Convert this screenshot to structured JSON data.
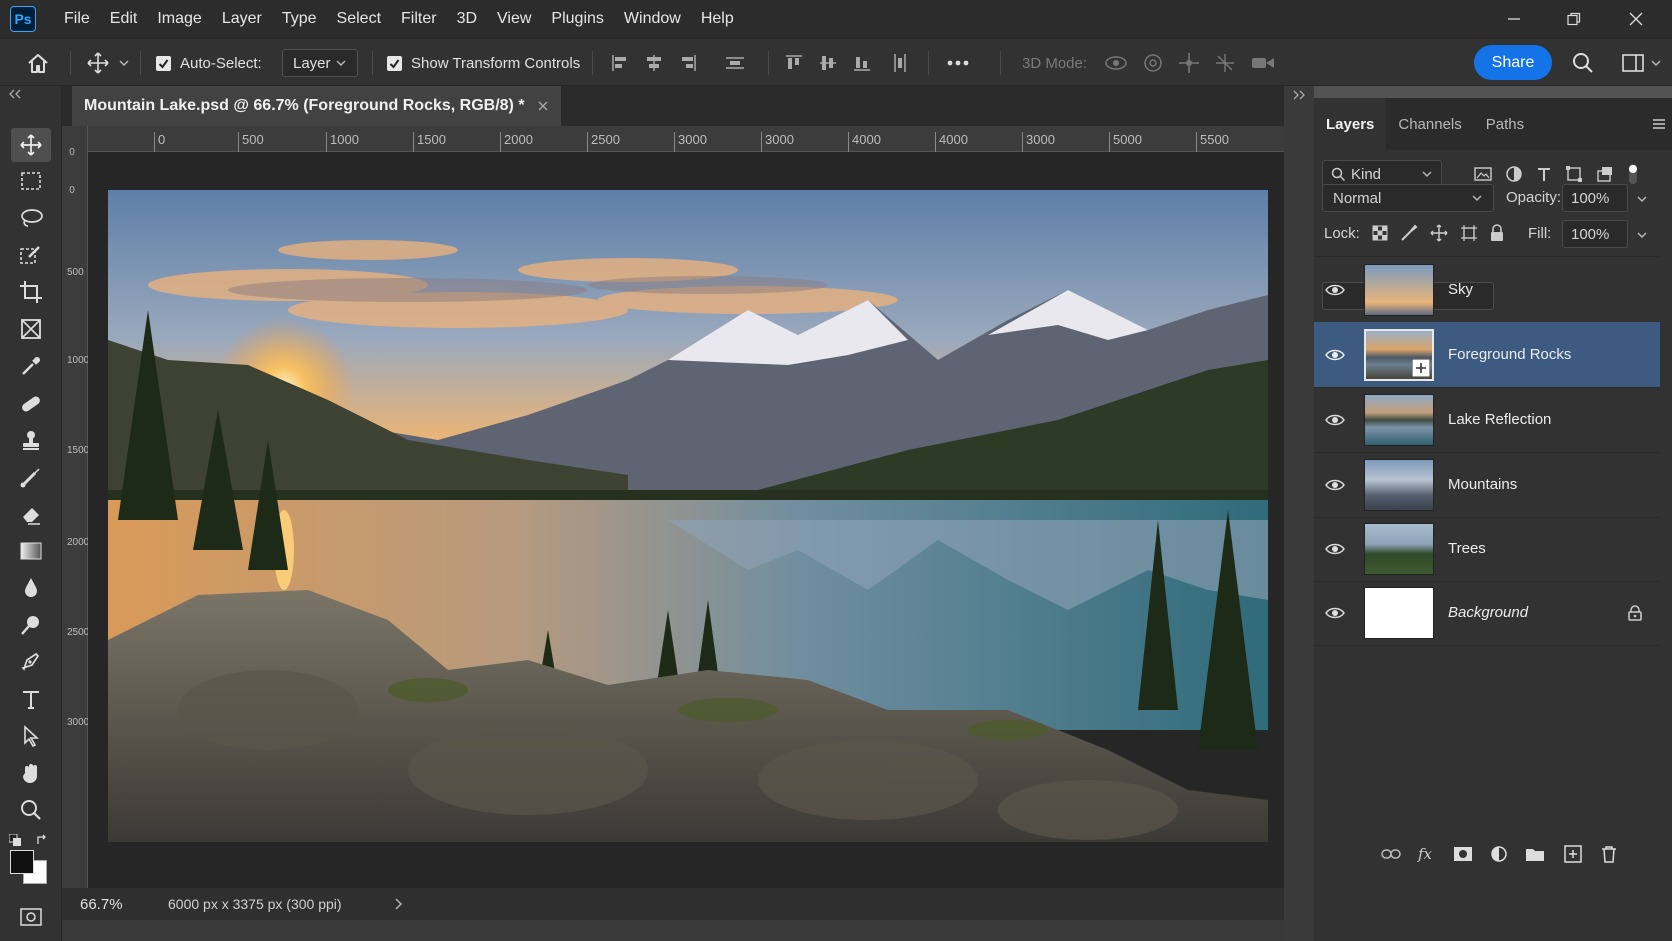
{
  "app": {
    "logo": "Ps"
  },
  "menu": [
    "File",
    "Edit",
    "Image",
    "Layer",
    "Type",
    "Select",
    "Filter",
    "3D",
    "View",
    "Plugins",
    "Window",
    "Help"
  ],
  "window_controls": [
    "minimize-icon",
    "restore-icon",
    "close-icon"
  ],
  "options": {
    "auto_select_label": "Auto-Select:",
    "auto_select_checked": true,
    "auto_select_target": "Layer",
    "show_transform_label": "Show Transform Controls",
    "show_transform_checked": true,
    "mode_3d_label": "3D Mode:",
    "share_label": "Share"
  },
  "document": {
    "tab_title": "Mountain Lake.psd @ 66.7% (Foreground Rocks, RGB/8) *",
    "ruler_top": [
      "0",
      "500",
      "1000",
      "1500",
      "2000",
      "2500",
      "3000",
      "3000",
      "4000",
      "4000",
      "3000",
      "5000",
      "5500"
    ],
    "ruler_left": [
      "0",
      "0",
      "500",
      "1000",
      "1500",
      "2000",
      "2500",
      "3000"
    ],
    "zoom": "66.7%",
    "dimensions": "6000 px x 3375 px (300 ppi)"
  },
  "layers_panel": {
    "tabs": [
      "Layers",
      "Channels",
      "Paths"
    ],
    "active_tab": "Layers",
    "filter_kind": "Kind",
    "blend_mode": "Normal",
    "opacity_label": "Opacity:",
    "opacity_value": "100%",
    "lock_label": "Lock:",
    "fill_label": "Fill:",
    "fill_value": "100%",
    "layers": [
      {
        "name": "Sky",
        "visible": true,
        "selected": false,
        "locked": false,
        "thumb": "sky"
      },
      {
        "name": "Foreground Rocks",
        "visible": true,
        "selected": true,
        "locked": false,
        "thumb": "rocks"
      },
      {
        "name": "Lake Reflection",
        "visible": true,
        "selected": false,
        "locked": false,
        "thumb": "lake"
      },
      {
        "name": "Mountains",
        "visible": true,
        "selected": false,
        "locked": false,
        "thumb": "mountains"
      },
      {
        "name": "Trees",
        "visible": true,
        "selected": false,
        "locked": false,
        "thumb": "trees"
      },
      {
        "name": "Background",
        "visible": true,
        "selected": false,
        "locked": true,
        "thumb": "white"
      }
    ]
  },
  "colors": {
    "accent": "#1473e6",
    "selected_layer": "#3d5a80",
    "ps_blue": "#31a8ff"
  }
}
